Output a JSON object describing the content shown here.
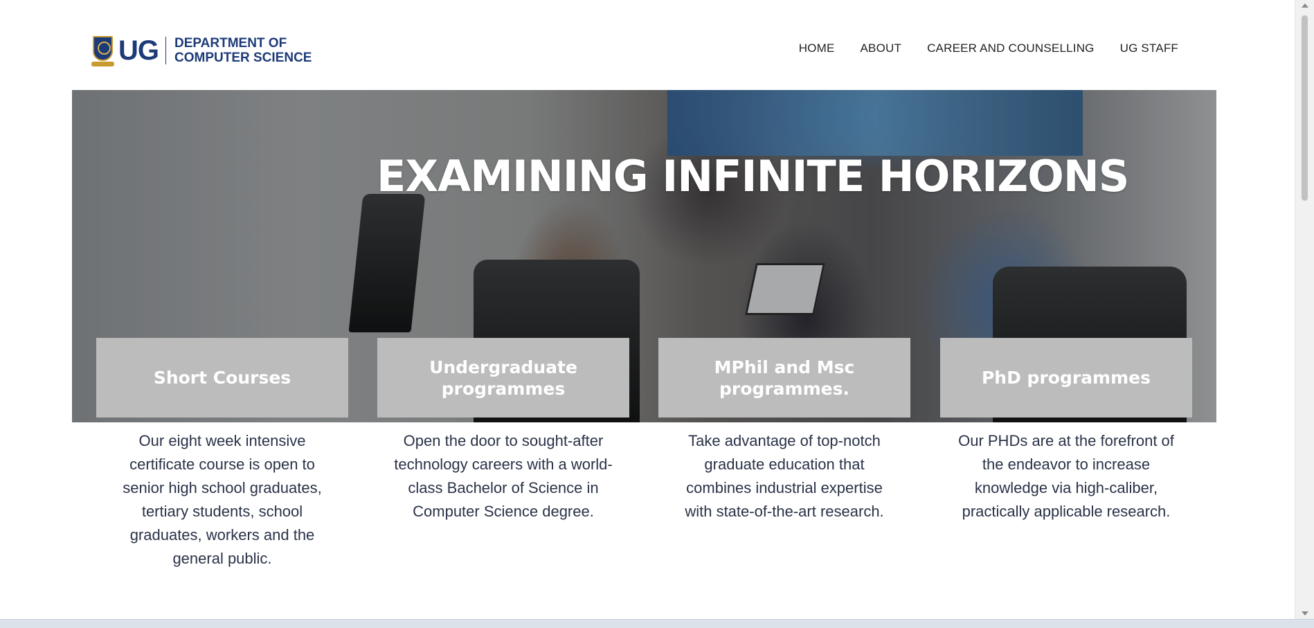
{
  "header": {
    "logo_ug": "UG",
    "logo_line1": "DEPARTMENT OF",
    "logo_line2": "COMPUTER SCIENCE"
  },
  "nav": {
    "items": [
      "HOME",
      "ABOUT",
      "CAREER AND COUNSELLING",
      "UG STAFF"
    ]
  },
  "hero": {
    "title": "EXAMINING INFINITE HORIZONS"
  },
  "cards": [
    {
      "title": "Short Courses",
      "text": "Our eight week intensive certificate course is open to senior high school graduates, tertiary students, school graduates, workers and the general public."
    },
    {
      "title": "Undergraduate programmes",
      "text": "Open the door to sought-after technology careers with a world-class Bachelor of Science in Computer Science degree."
    },
    {
      "title": "MPhil and Msc programmes.",
      "text": "Take advantage of top-notch graduate education that combines industrial expertise with state-of-the-art research."
    },
    {
      "title": "PhD programmes",
      "text": "Our PHDs are at the forefront of the endeavor to increase knowledge via high-caliber, practically applicable research."
    }
  ],
  "colors": {
    "brand_navy": "#1d3b78",
    "card_header_gray": "#bcbcbc",
    "body_text": "#2a3247"
  }
}
